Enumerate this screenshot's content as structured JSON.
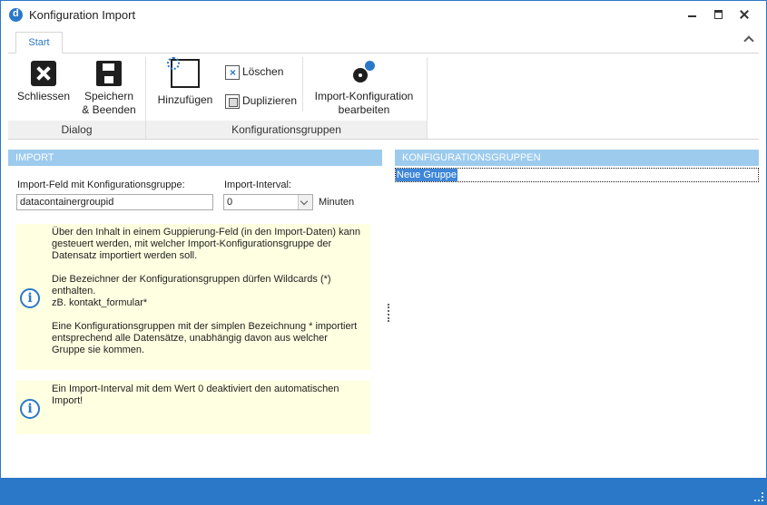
{
  "window": {
    "title": "Konfiguration Import"
  },
  "ribbon": {
    "tabs": [
      "Start"
    ],
    "groups": {
      "dialog": {
        "label": "Dialog",
        "close_label": "Schliessen",
        "save_label_1": "Speichern",
        "save_label_2": "& Beenden"
      },
      "konfig": {
        "label": "Konfigurationsgruppen",
        "add_label": "Hinzufügen",
        "delete_label": "Löschen",
        "duplicate_label": "Duplizieren",
        "edit_label_1": "Import-Konfiguration",
        "edit_label_2": "bearbeiten"
      }
    }
  },
  "import": {
    "header": "IMPORT",
    "field_label": "Import-Feld mit Konfigurationsgruppe:",
    "field_value": "datacontainergroupid",
    "interval_label": "Import-Interval:",
    "interval_value": "0",
    "interval_unit": "Minuten",
    "info1": {
      "p1": "Über den Inhalt in einem Guppierung-Feld (in den Import-Daten) kann gesteuert werden, mit welcher Import-Konfigurationsgruppe der Datensatz importiert werden soll.",
      "p2a": "Die Bezeichner der Konfigurationsgruppen dürfen Wildcards (*) enthalten.",
      "p2b": "zB. kontakt_formular*",
      "p3": "Eine Konfigurationsgruppen mit der simplen Bezeichnung * importiert entsprechend alle Datensätze, unabhängig davon aus welcher Gruppe sie kommen."
    },
    "info2": {
      "p1": "Ein Import-Interval mit dem Wert 0 deaktiviert den automatischen Import!"
    }
  },
  "groups_panel": {
    "header": "KONFIGURATIONSGRUPPEN",
    "items": [
      "Neue Gruppe"
    ]
  },
  "colors": {
    "accent": "#2b78c9",
    "section_header": "#9dcbee",
    "info_background": "#ffffe1"
  }
}
